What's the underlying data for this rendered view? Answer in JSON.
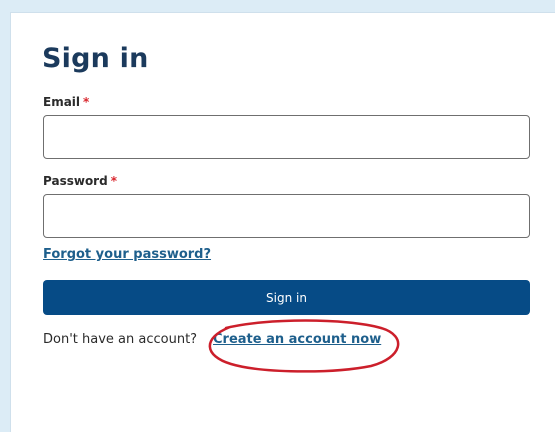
{
  "form": {
    "title": "Sign in",
    "email_label": "Email",
    "password_label": "Password",
    "required_marker": "*",
    "email_value": "",
    "password_value": "",
    "forgot_link": "Forgot your password?",
    "signin_button": "Sign in",
    "no_account_text": "Don't have an account?",
    "create_account_link": "Create an account now"
  },
  "colors": {
    "title": "#1b3a5c",
    "button_bg": "#064b86",
    "link": "#1e5f8c",
    "required": "#d9272e",
    "annotation": "#cc1f2b",
    "page_bg": "#dcecf6"
  }
}
